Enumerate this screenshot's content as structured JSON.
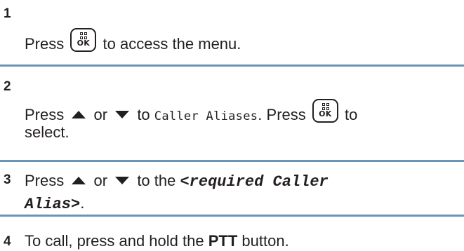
{
  "icons": {
    "ok_key": "menu-ok-key-icon",
    "up": "up-arrow-icon",
    "down": "down-arrow-icon",
    "ok_key_label": "OK"
  },
  "colors": {
    "divider": "#6b93b3",
    "text": "#231f20"
  },
  "steps": [
    {
      "number": "1",
      "press": "Press",
      "suffix": "to access the menu."
    },
    {
      "number": "2",
      "press": "Press",
      "or": "or",
      "to": "to",
      "menu_item": "Caller Aliases",
      "period_press": ". Press",
      "to_end": "to",
      "line2": "select."
    },
    {
      "number": "3",
      "press": "Press",
      "or": "or",
      "to_the": "to the",
      "placeholder_part1": "<required Caller",
      "placeholder_part2": "Alias>",
      "period": "."
    },
    {
      "number": "4",
      "text_before": "To call, press and hold the",
      "bold": "PTT",
      "text_after": "button."
    }
  ]
}
